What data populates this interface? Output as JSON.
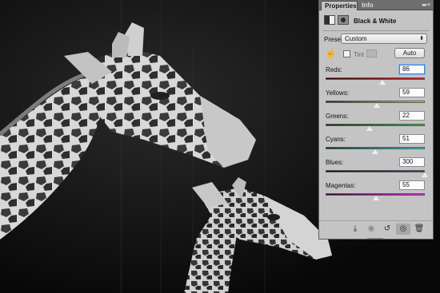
{
  "panel": {
    "tabs": [
      {
        "label": "Properties",
        "active": true
      },
      {
        "label": "Info",
        "active": false
      }
    ],
    "menu_icon": "panel-menu-icon",
    "title": "Black & White",
    "icons": [
      "adjustment-layer-icon",
      "layer-mask-icon"
    ]
  },
  "preset": {
    "label": "Preset:",
    "value": "Custom",
    "arrow_icon": "updown-arrows-icon"
  },
  "controls": {
    "hand_icon": "targeted-adjustment-hand-icon",
    "tint_label": "Tint",
    "tint_checked": false,
    "auto_label": "Auto"
  },
  "sliders": [
    {
      "label": "Reds:",
      "value": "86",
      "min": -200,
      "max": 300,
      "active": true,
      "colors": [
        "#2a0000",
        "#d21818"
      ]
    },
    {
      "label": "Yellows:",
      "value": "59",
      "min": -200,
      "max": 300,
      "active": false,
      "colors": [
        "#2a2a00",
        "#e6df22"
      ]
    },
    {
      "label": "Greens:",
      "value": "22",
      "min": -200,
      "max": 300,
      "active": false,
      "colors": [
        "#002a00",
        "#22c43a"
      ]
    },
    {
      "label": "Cyans:",
      "value": "51",
      "min": -200,
      "max": 300,
      "active": false,
      "colors": [
        "#002a2a",
        "#25d2d8"
      ]
    },
    {
      "label": "Blues:",
      "value": "300",
      "min": -200,
      "max": 300,
      "active": false,
      "colors": [
        "#00002a",
        "#2230d6"
      ]
    },
    {
      "label": "Magentas:",
      "value": "55",
      "min": -200,
      "max": 300,
      "active": false,
      "colors": [
        "#2a002a",
        "#d62ad8"
      ]
    }
  ],
  "bottom_bar": [
    {
      "name": "clip-to-layer-icon",
      "enabled": true
    },
    {
      "name": "view-previous-state-icon",
      "enabled": false
    },
    {
      "name": "reset-adjustment-icon",
      "enabled": true
    },
    {
      "name": "visibility-eye-icon",
      "enabled": true
    },
    {
      "name": "trash-icon",
      "enabled": true
    }
  ]
}
